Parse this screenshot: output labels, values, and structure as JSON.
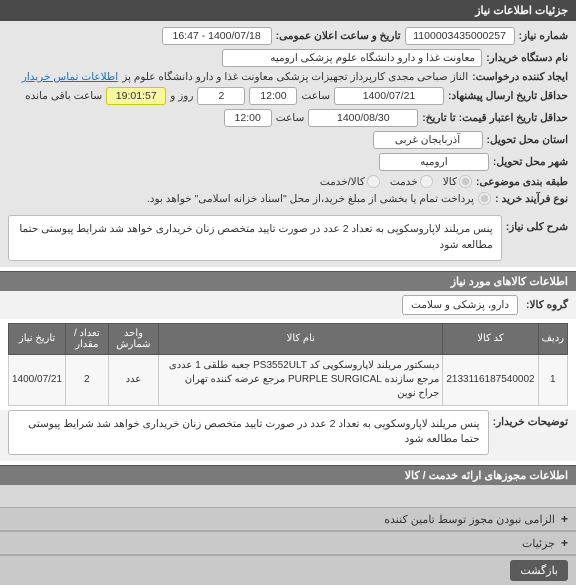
{
  "header": {
    "title": "جزئیات اطلاعات نیاز"
  },
  "info": {
    "need_no_label": "شماره نیاز:",
    "need_no": "1100003435000257",
    "pub_date_label": "تاریخ و ساعت اعلان عمومی:",
    "pub_date": "1400/07/18 - 16:47",
    "buyer_label": "نام دستگاه خریدار:",
    "buyer": "معاونت غذا و دارو دانشگاه علوم پزشکی ارومیه",
    "creator_label": "ایجاد کننده درخواست:",
    "creator": "الناز صباحی مجدی کارپرداز تجهیزات پزشکی معاونت غذا و دارو دانشگاه علوم پز",
    "contact_link": "اطلاعات تماس خریدار",
    "min_send_label": "حداقل تاریخ ارسال پیشنهاد:",
    "min_send_date": "1400/07/21",
    "time_lbl": "ساعت",
    "min_send_time": "12:00",
    "day_lbl": "روز و",
    "days": "2",
    "countdown_lbl": "ساعت باقی مانده",
    "countdown": "19:01:57",
    "valid_label": "حداقل تاریخ اعتبار قیمت: تا تاریخ:",
    "valid_date": "1400/08/30",
    "valid_time": "12:00",
    "province_label": "استان محل تحویل:",
    "province": "آذربایجان غربی",
    "city_label": "شهر محل تحویل:",
    "city": "ارومیه",
    "cat_label": "طبقه بندی موضوعی:",
    "cat_goods": "کالا",
    "cat_service": "خدمت",
    "cat_goods_service": "کالا/خدمت",
    "proc_label": "نوع فرآیند خرید :",
    "proc_text": "پرداخت تمام یا بخشی از مبلغ خرید،از محل \"اسناد خزانه اسلامی\" خواهد بود."
  },
  "summary": {
    "label": "شرح کلی نیاز:",
    "text": "پنس مریلند لاپاروسکوپی به تعداد 2 عدد در صورت تایید متخصص زنان خریداری خواهد شد شرایط پیوستی حتما مطالعه شود"
  },
  "goods": {
    "header": "اطلاعات کالاهای مورد نیاز",
    "group_label": "گروه کالا:",
    "group": "دارو، پزشکی و سلامت",
    "cols": {
      "row": "ردیف",
      "code": "کد کالا",
      "name": "نام کالا",
      "unit": "واحد شمارش",
      "qty": "تعداد / مقدار",
      "date": "تاریخ نیاز"
    },
    "items": [
      {
        "row": "1",
        "code": "2133116187540002",
        "name": "دیسکتور مریلند لاپاروسکوپی کد PS3552ULT جعبه طلقی 1 عددی مرجع سازنده PURPLE SURGICAL مرجع عرضه کننده تهران جراح نوین",
        "unit": "عدد",
        "qty": "2",
        "date": "1400/07/21"
      }
    ],
    "extra_label": "توضیحات خریدار:",
    "extra": "پنس مریلند لاپاروسکوپی به تعداد 2 عدد در صورت تایید متخصص زنان خریداری خواهد شد شرایط پیوستی حتما مطالعه شود"
  },
  "licenses": {
    "header": "اطلاعات مجوزهای ارائه خدمت / کالا"
  },
  "acc": {
    "a1": "الزامی نبودن مجوز توسط تامین کننده",
    "a2": "جزئیات"
  },
  "btn": {
    "back": "بازگشت"
  }
}
